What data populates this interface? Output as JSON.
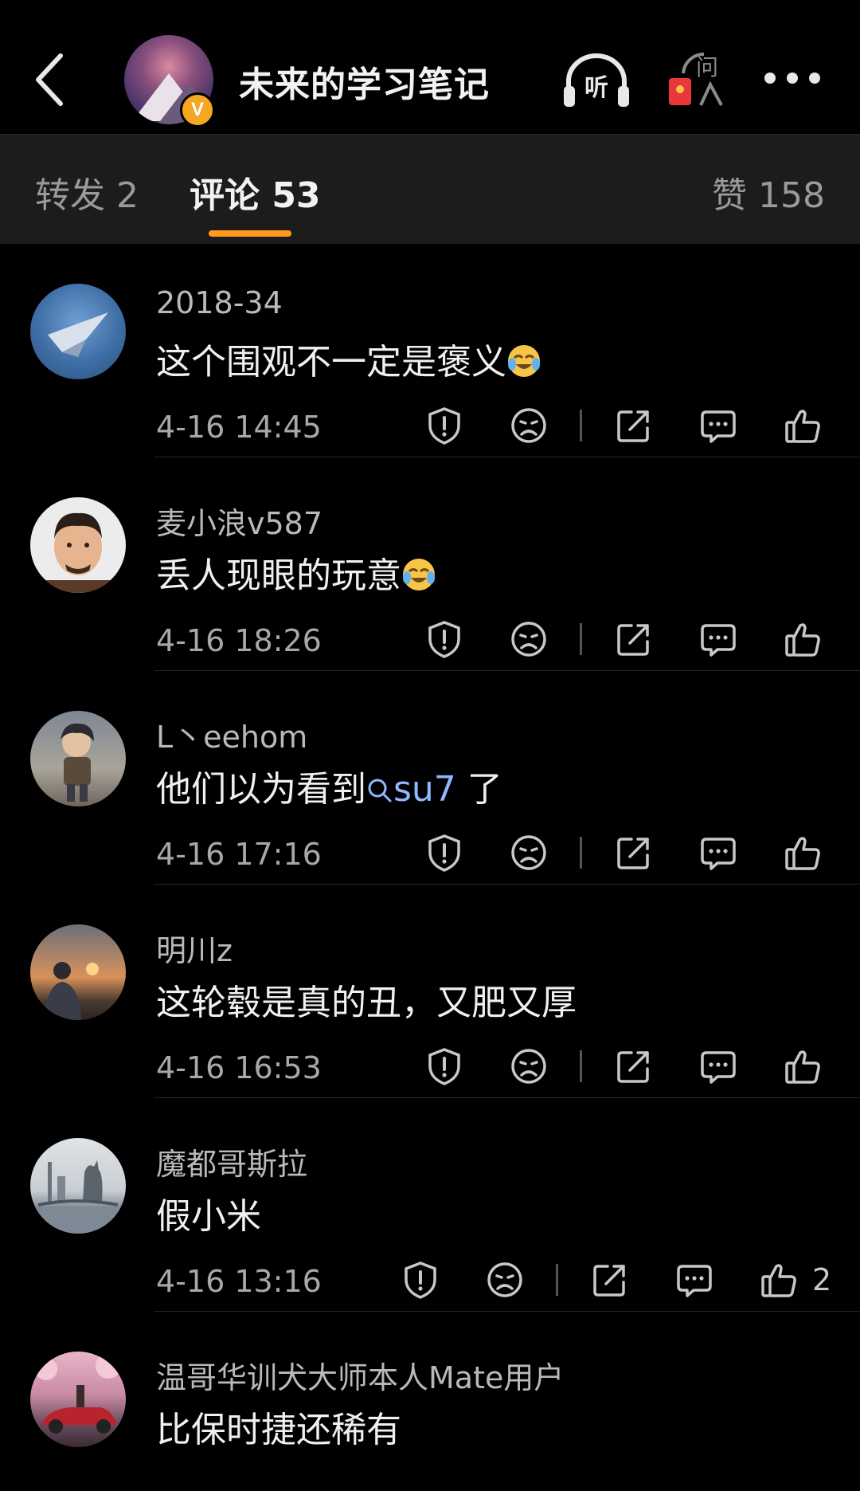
{
  "header": {
    "title": "未来的学习笔记",
    "listen_label": "听",
    "ask_label": "问",
    "verified_badge": "V"
  },
  "tabs": {
    "repost": "转发 2",
    "comment": "评论 53",
    "like": "赞 158"
  },
  "colors": {
    "accent": "#ff9a1f",
    "topic_link": "#8fb8ff",
    "verified": "#f5a623"
  },
  "comments": [
    {
      "username": "2018-34",
      "content": "这个围观不一定是褒义",
      "emoji": "laugh-cry",
      "time": "4-16 14:45",
      "likes": ""
    },
    {
      "username": "麦小浪v587",
      "content": "丢人现眼的玩意",
      "emoji": "laugh-cry",
      "time": "4-16 18:26",
      "likes": ""
    },
    {
      "username": "L丶eehom",
      "content_before": "他们以为看到",
      "topic": "su7",
      "content_after": " 了",
      "time": "4-16 17:16",
      "likes": ""
    },
    {
      "username": "明川z",
      "content": "这轮毂是真的丑，又肥又厚",
      "time": "4-16 16:53",
      "likes": ""
    },
    {
      "username": "魔都哥斯拉",
      "content": "假小米",
      "time": "4-16 13:16",
      "likes": "2"
    },
    {
      "username": "温哥华训犬大师本人Mate用户",
      "content": "比保时捷还稀有",
      "time": "",
      "likes": ""
    }
  ]
}
